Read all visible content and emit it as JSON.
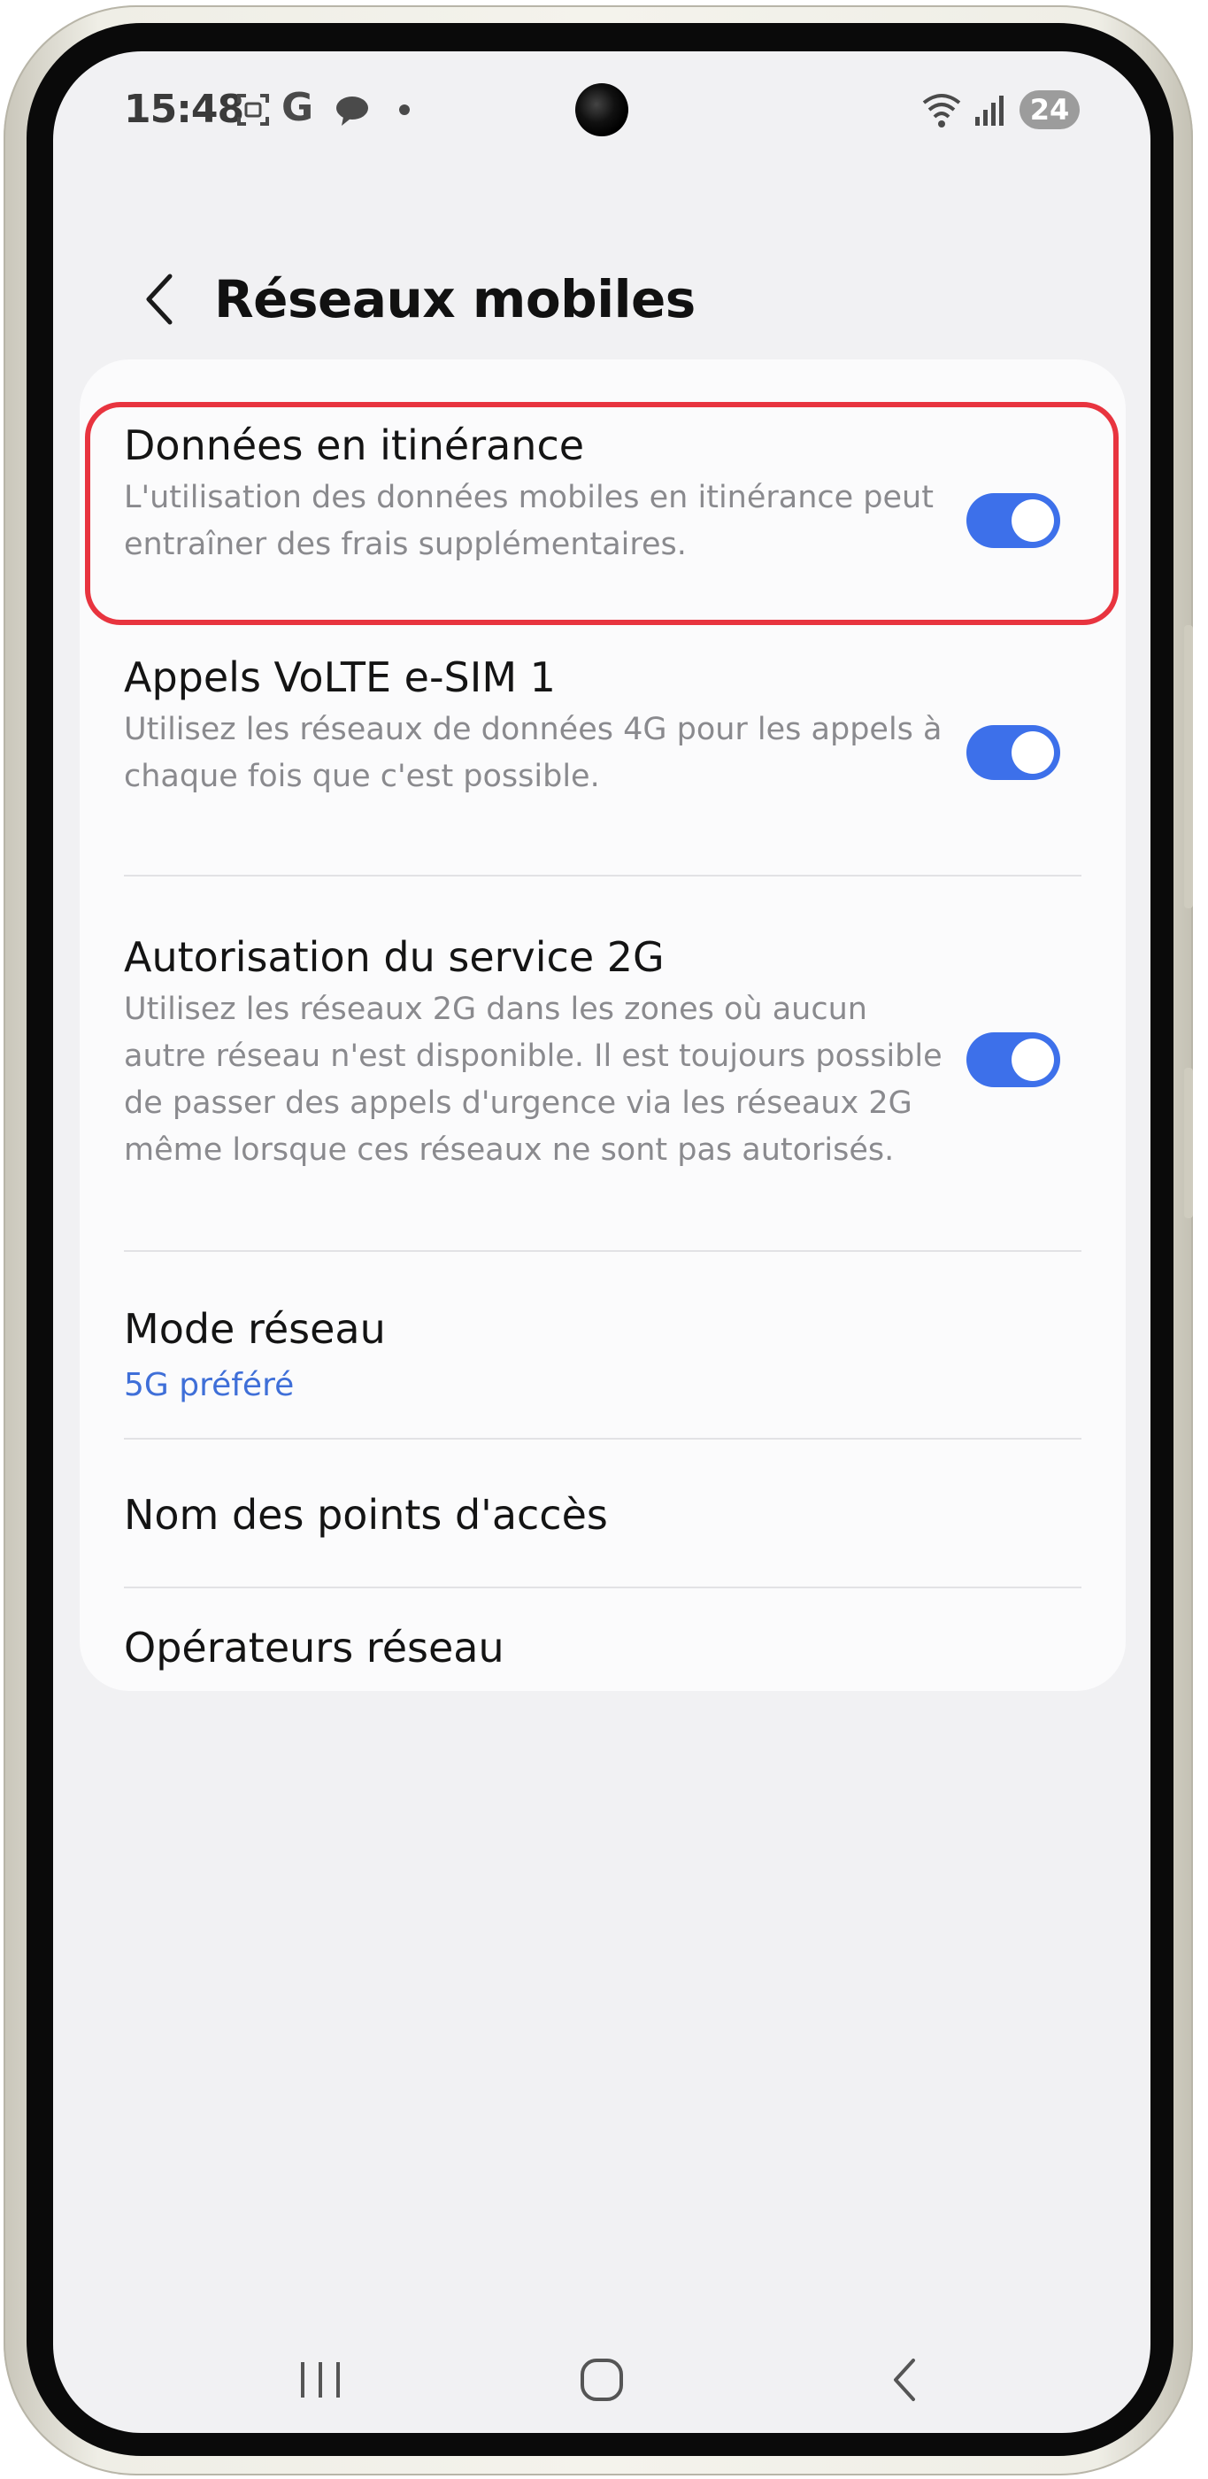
{
  "status_bar": {
    "time": "15:48",
    "battery_level": "24",
    "icons": [
      "screenshot-icon",
      "google-icon",
      "chat-bubble-icon",
      "dot-icon",
      "wifi-call-icon",
      "signal-icon"
    ]
  },
  "header": {
    "title": "Réseaux mobiles"
  },
  "settings": {
    "items": [
      {
        "title": "Données en itinérance",
        "description": "L'utilisation des données mobiles en itinérance peut entraîner des frais supplémentaires.",
        "toggle_on": true
      },
      {
        "title": "Appels VoLTE e-SIM 1",
        "description": "Utilisez les réseaux de données 4G pour les appels à chaque fois que c'est possible.",
        "toggle_on": true
      },
      {
        "title": "Autorisation du service 2G",
        "description": "Utilisez les réseaux 2G dans les zones où aucun autre réseau n'est disponible. Il est toujours possible de passer des appels d'urgence via les réseaux 2G même lorsque ces réseaux ne sont pas autorisés.",
        "toggle_on": true
      },
      {
        "title": "Mode réseau",
        "value": "5G préféré"
      },
      {
        "title": "Nom des points d'accès"
      },
      {
        "title": "Opérateurs réseau"
      }
    ]
  },
  "colors": {
    "accent": "#3d70ea",
    "highlight": "#e8343f",
    "value_text": "#3f6fd8"
  }
}
